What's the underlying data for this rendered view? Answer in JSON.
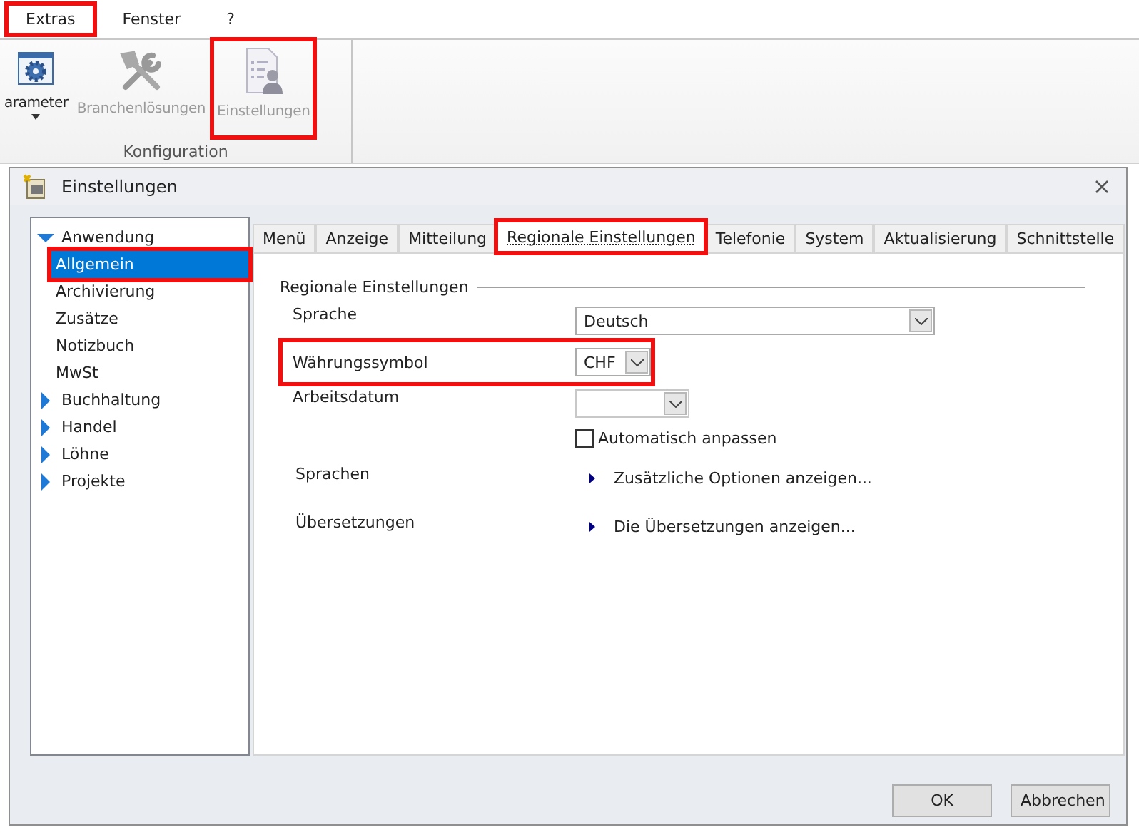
{
  "menu": [
    {
      "label": "Extras",
      "highlighted": true
    },
    {
      "label": "Fenster",
      "highlighted": false
    },
    {
      "label": "?",
      "highlighted": false
    }
  ],
  "ribbon": {
    "group": "Konfiguration",
    "buttons": [
      {
        "kind": "gear",
        "label": "arameter",
        "disabled": false,
        "dropdown": true,
        "highlighted": false
      },
      {
        "kind": "tools",
        "label": "Branchenlösungen",
        "disabled": true,
        "dropdown": false,
        "highlighted": false
      },
      {
        "kind": "settings",
        "label": "Einstellungen",
        "disabled": true,
        "dropdown": false,
        "highlighted": true
      }
    ]
  },
  "dialog": {
    "title": "Einstellungen",
    "tree": [
      {
        "label": "Anwendung",
        "expanded": true,
        "selected": false,
        "highlighted": false,
        "children": [
          {
            "label": "Allgemein",
            "selected": true,
            "highlighted": true
          },
          {
            "label": "Archivierung",
            "selected": false,
            "highlighted": false
          },
          {
            "label": "Zusätze",
            "selected": false,
            "highlighted": false
          },
          {
            "label": "Notizbuch",
            "selected": false,
            "highlighted": false
          },
          {
            "label": "MwSt",
            "selected": false,
            "highlighted": false
          }
        ]
      },
      {
        "label": "Buchhaltung",
        "expanded": false,
        "selected": false,
        "highlighted": false
      },
      {
        "label": "Handel",
        "expanded": false,
        "selected": false,
        "highlighted": false
      },
      {
        "label": "Löhne",
        "expanded": false,
        "selected": false,
        "highlighted": false
      },
      {
        "label": "Projekte",
        "expanded": false,
        "selected": false,
        "highlighted": false
      }
    ],
    "tabs": [
      {
        "label": "Menü",
        "selected": false,
        "highlighted": false
      },
      {
        "label": "Anzeige",
        "selected": false,
        "highlighted": false
      },
      {
        "label": "Mitteilung",
        "selected": false,
        "highlighted": false
      },
      {
        "label": "Regionale Einstellungen",
        "selected": true,
        "highlighted": true
      },
      {
        "label": "Telefonie",
        "selected": false,
        "highlighted": false
      },
      {
        "label": "System",
        "selected": false,
        "highlighted": false
      },
      {
        "label": "Aktualisierung",
        "selected": false,
        "highlighted": false
      },
      {
        "label": "Schnittstelle",
        "selected": false,
        "highlighted": false
      }
    ],
    "section": "Regionale Einstellungen",
    "fields": [
      {
        "kind": "combo",
        "label": "Sprache",
        "value": "Deutsch",
        "disabled": false,
        "highlighted": false
      },
      {
        "kind": "combo",
        "label": "Währungssymbol",
        "value": "CHF",
        "disabled": false,
        "highlighted": true
      },
      {
        "kind": "combo",
        "label": "Arbeitsdatum",
        "disabled": true,
        "highlighted": false
      },
      {
        "kind": "checkbox",
        "label": "Automatisch anpassen",
        "checked": false
      },
      {
        "kind": "link",
        "label": "Sprachen",
        "value": "Zusätzliche Optionen anzeigen..."
      },
      {
        "kind": "link",
        "label": "Übersetzungen",
        "value": "Die Übersetzungen anzeigen..."
      }
    ],
    "buttons": [
      "OK",
      "Abbrechen"
    ]
  }
}
